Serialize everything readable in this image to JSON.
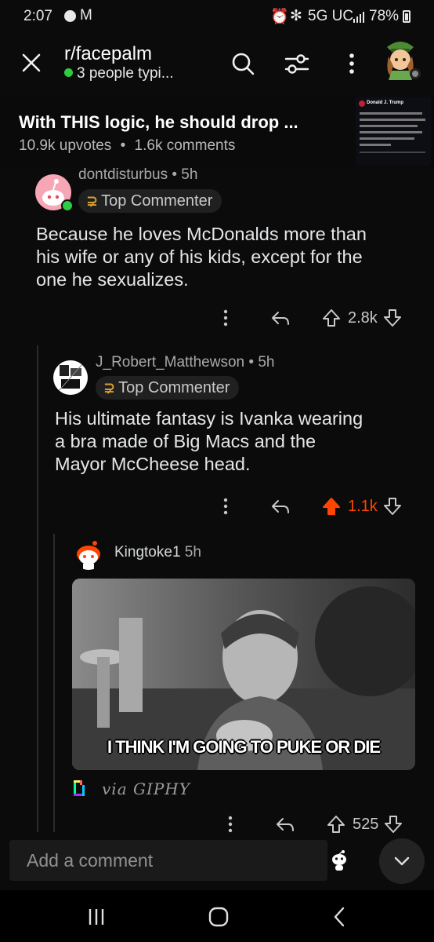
{
  "status_bar": {
    "time": "2:07",
    "network": "5G UC",
    "battery": "78%"
  },
  "header": {
    "subreddit": "r/facepalm",
    "typing": "3 people typi..."
  },
  "post": {
    "title": "With THIS logic, he should drop ...",
    "upvotes": "10.9k upvotes",
    "separator": "•",
    "comments": "1.6k comments",
    "thumbnail_name": "Donald J. Trump"
  },
  "comments": [
    {
      "user": "dontdisturbus",
      "age": "• 5h",
      "badge": "Top Commenter",
      "lines": [
        "Because he loves McDonalds more than",
        "his wife or any of his kids, except for the",
        "one he sexualizes."
      ],
      "score": "2.8k",
      "upvoted": false
    },
    {
      "user": "J_Robert_Matthewson",
      "age": "• 5h",
      "badge": "Top Commenter",
      "lines": [
        "His ultimate fantasy is Ivanka wearing",
        "a bra made of Big Macs and the",
        "Mayor McCheese head."
      ],
      "score": "1.1k",
      "upvoted": true
    },
    {
      "user": "Kingtoke1",
      "age": "5h",
      "gif_caption": "I THINK I'M GOING TO PUKE OR DIE",
      "via": "via GIPHY",
      "score": "525",
      "upvoted": false
    }
  ],
  "comment_box": {
    "placeholder": "Add a comment"
  },
  "colors": {
    "upvote_active": "#ff4500",
    "online_green": "#2ecc40",
    "badge_gold": "#d8a031"
  }
}
